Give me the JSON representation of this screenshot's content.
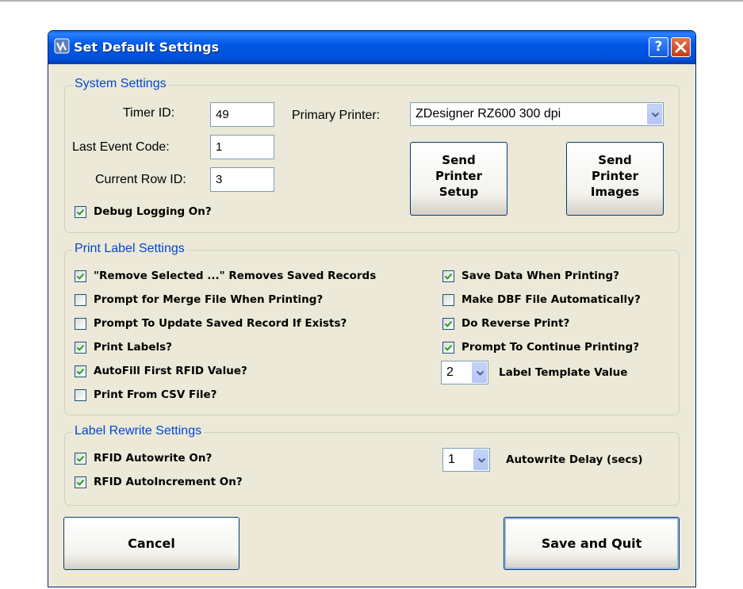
{
  "window": {
    "title": "Set Default Settings",
    "help_label": "?"
  },
  "system_settings": {
    "legend": "System Settings",
    "timer_id_label": "Timer ID:",
    "timer_id_value": "49",
    "last_event_code_label": "Last Event Code:",
    "last_event_code_value": "1",
    "current_row_id_label": "Current Row ID:",
    "current_row_id_value": "3",
    "debug_logging": {
      "label": "Debug Logging On?",
      "checked": true
    },
    "primary_printer_label": "Primary Printer:",
    "primary_printer_value": "ZDesigner RZ600 300 dpi",
    "send_printer_setup": [
      "Send",
      "Printer",
      "Setup"
    ],
    "send_printer_images": [
      "Send",
      "Printer",
      "Images"
    ]
  },
  "print_label_settings": {
    "legend": "Print Label Settings",
    "left_options": [
      {
        "label": "\"Remove Selected ...\" Removes Saved Records",
        "checked": true
      },
      {
        "label": "Prompt for Merge File When Printing?",
        "checked": false
      },
      {
        "label": "Prompt To Update Saved Record If Exists?",
        "checked": false
      },
      {
        "label": "Print Labels?",
        "checked": true
      },
      {
        "label": "AutoFill First RFID Value?",
        "checked": true
      },
      {
        "label": "Print From CSV File?",
        "checked": false
      }
    ],
    "right_options": [
      {
        "label": "Save Data When Printing?",
        "checked": true
      },
      {
        "label": "Make DBF File Automatically?",
        "checked": false
      },
      {
        "label": "Do Reverse Print?",
        "checked": true
      },
      {
        "label": "Prompt To Continue Printing?",
        "checked": true
      }
    ],
    "label_template_value": "2",
    "label_template_label": "Label Template Value"
  },
  "label_rewrite_settings": {
    "legend": "Label Rewrite Settings",
    "rfid_autowrite": {
      "label": "RFID Autowrite On?",
      "checked": true
    },
    "rfid_autoincrement": {
      "label": "RFID AutoIncrement On?",
      "checked": true
    },
    "autowrite_delay_value": "1",
    "autowrite_delay_label": "Autowrite Delay (secs)"
  },
  "buttons": {
    "cancel": "Cancel",
    "save_and_quit": "Save and Quit"
  },
  "colors": {
    "titlebar": "#0054e3",
    "dialog_bg": "#ece9d8",
    "group_legend": "#0046d5",
    "close_button": "#d9562b",
    "checkmark": "#21a121"
  }
}
